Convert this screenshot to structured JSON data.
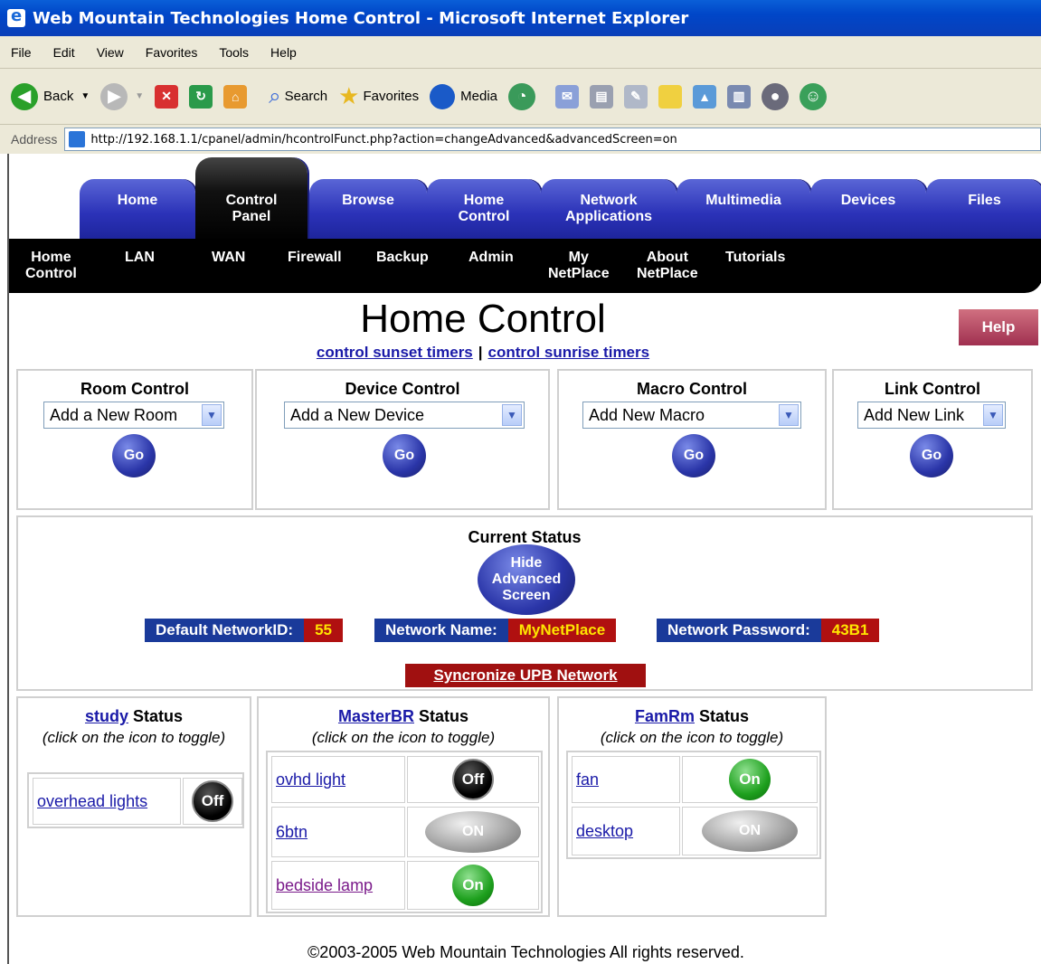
{
  "window": {
    "title": "Web Mountain Technologies Home Control - Microsoft Internet Explorer"
  },
  "menu": [
    "File",
    "Edit",
    "View",
    "Favorites",
    "Tools",
    "Help"
  ],
  "toolbar": {
    "back": "Back",
    "search": "Search",
    "favorites": "Favorites",
    "media": "Media"
  },
  "address": {
    "label": "Address",
    "url": "http://192.168.1.1/cpanel/admin/hcontrolFunct.php?action=changeAdvanced&advancedScreen=on"
  },
  "tabs": [
    {
      "label": "Home",
      "active": false
    },
    {
      "label": "Control Panel",
      "active": true
    },
    {
      "label": "Browse",
      "active": false
    },
    {
      "label": "Home Control",
      "active": false
    },
    {
      "label": "Network Applications",
      "active": false
    },
    {
      "label": "Multimedia",
      "active": false
    },
    {
      "label": "Devices",
      "active": false
    },
    {
      "label": "Files",
      "active": false
    }
  ],
  "subnav": [
    "Home Control",
    "LAN",
    "WAN",
    "Firewall",
    "Backup",
    "Admin",
    "My NetPlace",
    "About NetPlace",
    "Tutorials"
  ],
  "page": {
    "title": "Home Control",
    "help": "Help",
    "sunset_link": "control sunset timers",
    "separator": "|",
    "sunrise_link": "control sunrise timers"
  },
  "controls": [
    {
      "title": "Room Control",
      "select": "Add a New Room",
      "go": "Go"
    },
    {
      "title": "Device Control",
      "select": "Add a New Device",
      "go": "Go"
    },
    {
      "title": "Macro Control",
      "select": "Add New Macro",
      "go": "Go"
    },
    {
      "title": "Link Control",
      "select": "Add New Link",
      "go": "Go"
    }
  ],
  "status": {
    "title": "Current Status",
    "hide_button": "Hide Advanced Screen",
    "network_id_label": "Default NetworkID:",
    "network_id": "55",
    "network_name_label": "Network Name:",
    "network_name": "MyNetPlace",
    "network_password_label": "Network Password:",
    "network_password": "43B1",
    "sync": "Syncronize UPB Network"
  },
  "rooms": [
    {
      "name": "study",
      "status_word": "Status",
      "hint": "(click on the icon to toggle)",
      "devices": [
        {
          "name": "overhead lights",
          "state": "Off"
        }
      ]
    },
    {
      "name": "MasterBR",
      "status_word": "Status",
      "hint": "(click on the icon to toggle)",
      "devices": [
        {
          "name": "ovhd light",
          "state": "Off"
        },
        {
          "name": "6btn",
          "state": "ON"
        },
        {
          "name": "bedside lamp",
          "state": "On"
        }
      ]
    },
    {
      "name": "FamRm",
      "status_word": "Status",
      "hint": "(click on the icon to toggle)",
      "devices": [
        {
          "name": "fan",
          "state": "On"
        },
        {
          "name": "desktop",
          "state": "ON"
        }
      ]
    }
  ],
  "footer": "©2003-2005 Web Mountain Technologies All rights reserved."
}
